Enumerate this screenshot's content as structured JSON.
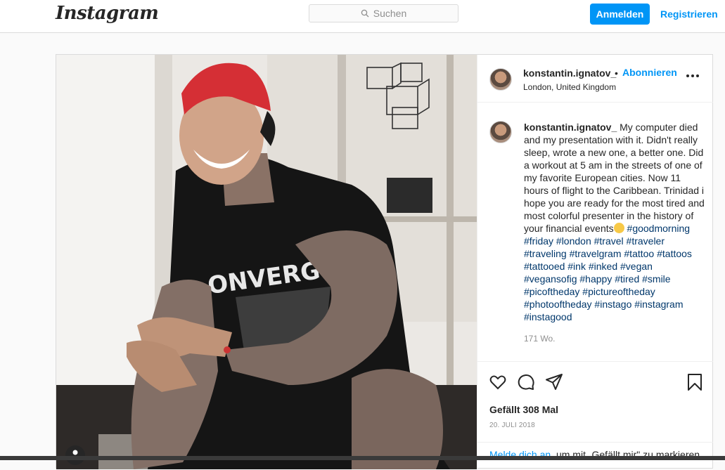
{
  "header": {
    "logo": "Instagram",
    "search_placeholder": "Suchen",
    "login_label": "Anmelden",
    "register_label": "Registrieren"
  },
  "post": {
    "username": "konstantin.ignatov_",
    "separator": "•",
    "follow_label": "Abonnieren",
    "location": "London, United Kingdom",
    "caption_text": "My computer died and my presentation with it. Didn't really sleep, wrote a new one, a better one. Did a workout at 5 am in the streets of one of my favorite European cities. Now 11 hours of flight to the Caribbean. Trinidad i hope you are ready for the most tired and most colorful presenter in the history of your financial events",
    "hashtags": "#goodmorning #friday #london #travel #traveler #traveling #travelgram #tattoo #tattoos #tattooed #ink #inked #vegan #vegansofig #happy #tired #smile #picoftheday #pictureoftheday #photooftheday #instago #instagram #instagood",
    "time_ago": "171 Wo.",
    "likes": "Gefällt 308 Mal",
    "date": "20. JULI 2018",
    "login_prompt_link": "Melde dich an,",
    "login_prompt_rest": " um mit „Gefällt mir\" zu markieren"
  },
  "colors": {
    "accent": "#0095f6",
    "hashtag": "#00376b",
    "border": "#dbdbdb",
    "background": "#fafafa"
  },
  "icons": [
    "search-icon",
    "more-options-icon",
    "heart-icon",
    "comment-icon",
    "share-icon",
    "bookmark-icon",
    "smiley-emoji-icon"
  ]
}
